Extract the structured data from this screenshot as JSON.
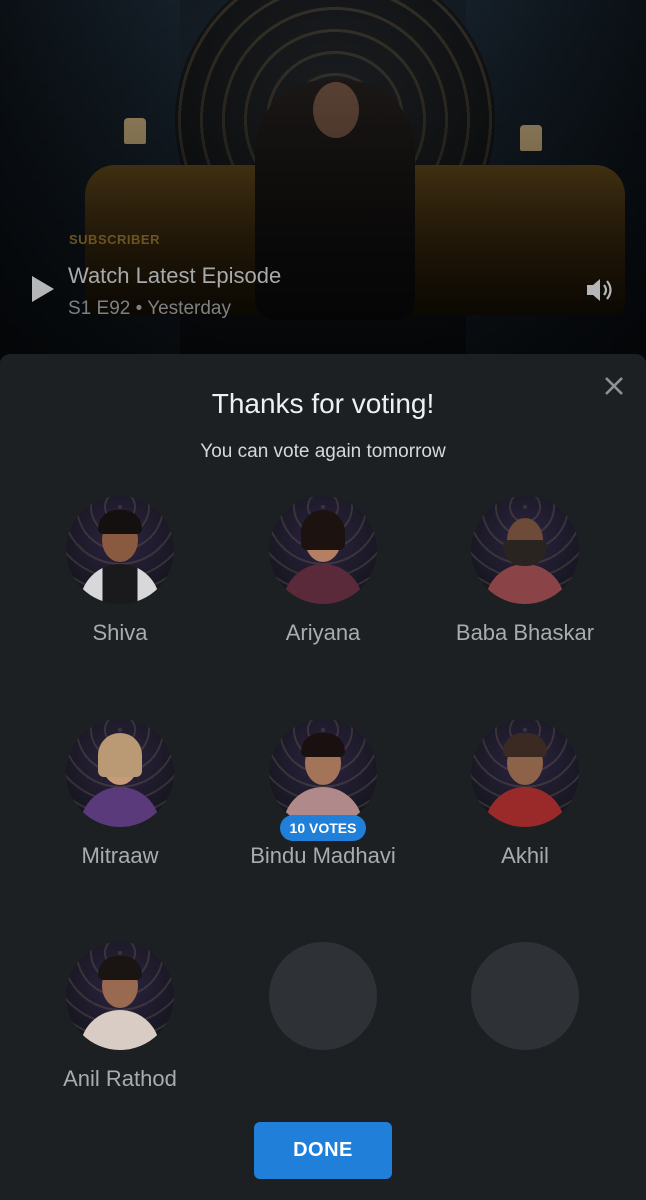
{
  "hero": {
    "badge": "SUBSCRIBER",
    "title": "Watch Latest Episode",
    "meta": "S1 E92 • Yesterday",
    "play_icon": "play-icon",
    "volume_icon": "volume-icon"
  },
  "dialog": {
    "title": "Thanks for voting!",
    "subtitle": "You can vote again tomorrow",
    "close_icon": "close-icon",
    "done_label": "DONE",
    "accent_color": "#1f7fd9"
  },
  "contestants": [
    {
      "name": "Shiva",
      "votes": ""
    },
    {
      "name": "Ariyana",
      "votes": ""
    },
    {
      "name": "Baba Bhaskar",
      "votes": ""
    },
    {
      "name": "Mitraaw",
      "votes": ""
    },
    {
      "name": "Bindu Madhavi",
      "votes": "10 VOTES"
    },
    {
      "name": "Akhil",
      "votes": ""
    },
    {
      "name": "Anil Rathod",
      "votes": ""
    }
  ]
}
